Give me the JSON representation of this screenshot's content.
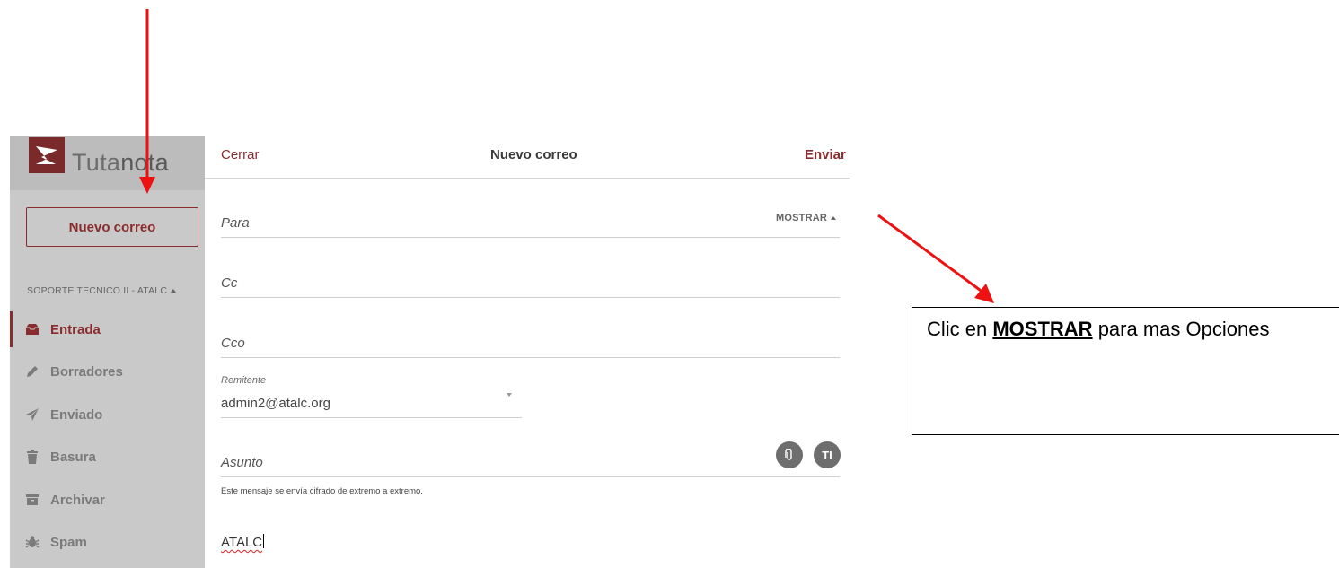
{
  "app": {
    "logo_text_a": "Tuta",
    "logo_text_b": "nota",
    "brand_color": "#8a2b2e"
  },
  "sidebar": {
    "new_mail_label": "Nuevo correo",
    "account_label": "SOPORTE TECNICO II - ATALC",
    "folders": [
      {
        "label": "Entrada",
        "icon": "inbox-icon",
        "active": true
      },
      {
        "label": "Borradores",
        "icon": "pencil-icon",
        "active": false
      },
      {
        "label": "Enviado",
        "icon": "paper-plane-icon",
        "active": false
      },
      {
        "label": "Basura",
        "icon": "trash-icon",
        "active": false
      },
      {
        "label": "Archivar",
        "icon": "archive-icon",
        "active": false
      },
      {
        "label": "Spam",
        "icon": "bug-icon",
        "active": false
      }
    ]
  },
  "compose": {
    "close_label": "Cerrar",
    "title": "Nuevo correo",
    "send_label": "Enviar",
    "to_label": "Para",
    "show_label": "MOSTRAR",
    "cc_label": "Cc",
    "bcc_label": "Cco",
    "sender_label": "Remitente",
    "sender_value": "admin2@atalc.org",
    "subject_label": "Asunto",
    "encryption_note": "Este mensaje se envía cifrado de extremo a extremo.",
    "format_icon_text": "TI",
    "body_text": "ATALC"
  },
  "annotation": {
    "text_before": "Clic en ",
    "text_bold": "MOSTRAR",
    "text_after": " para mas Opciones"
  }
}
